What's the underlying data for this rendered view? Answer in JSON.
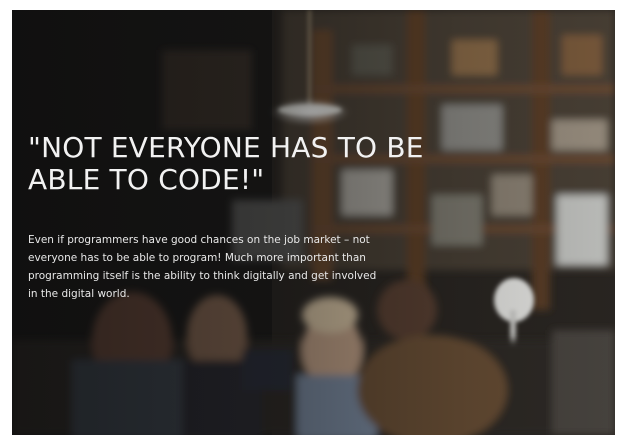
{
  "hero": {
    "headline": "\"NOT EVERYONE HAS TO BE ABLE TO CODE!\"",
    "body": "Even if programmers have good chances on the job market – not everyone has to be able to program! Much more important than programming itself is the ability to think digitally and get involved in the digital world."
  },
  "colors": {
    "overlay": "#0a0a0a",
    "text": "#f2f2f2",
    "background": "#1d1c1a"
  }
}
